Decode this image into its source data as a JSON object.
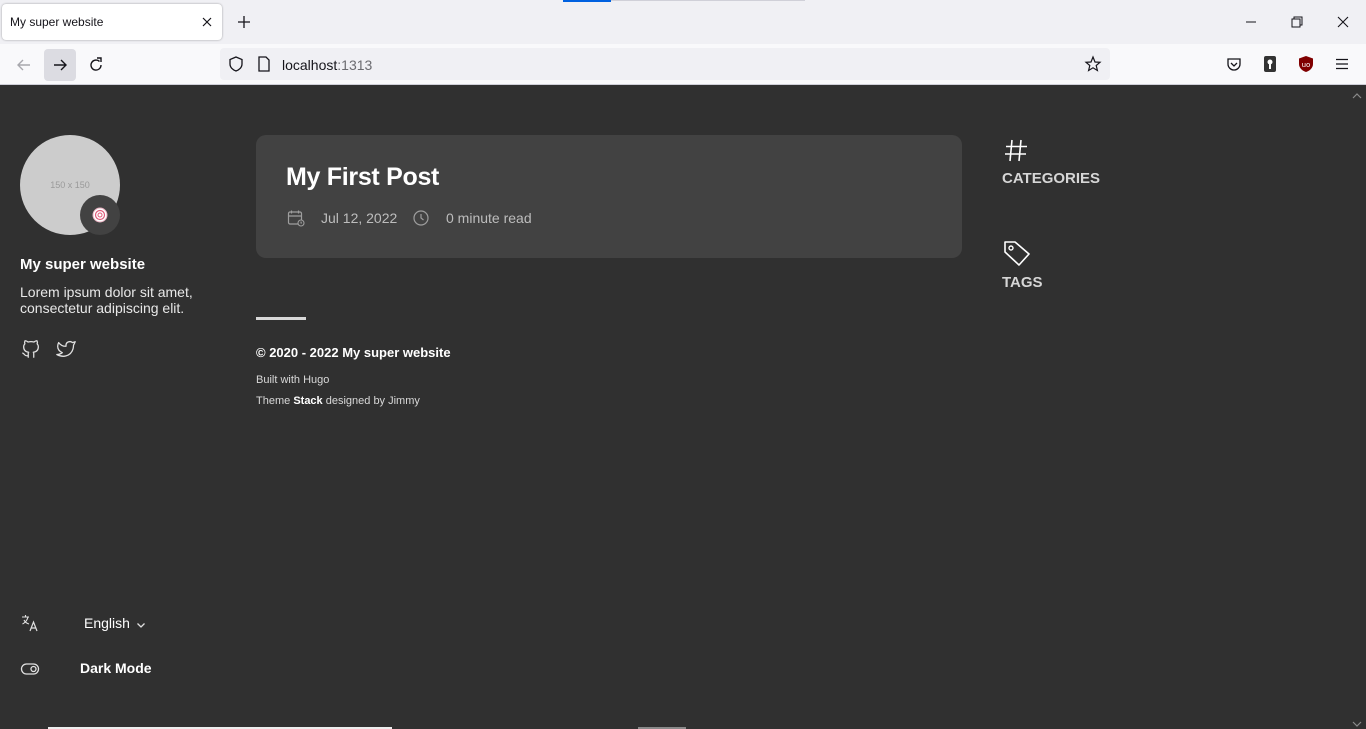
{
  "browser": {
    "tab_title": "My super website",
    "url_host": "localhost",
    "url_port": ":1313"
  },
  "sidebar": {
    "avatar_placeholder": "150 x 150",
    "site_title": "My super website",
    "site_description": "Lorem ipsum dolor sit amet, consectetur adipiscing elit.",
    "language": "English",
    "dark_mode_label": "Dark Mode"
  },
  "post": {
    "title": "My First Post",
    "date": "Jul 12, 2022",
    "read_time": "0 minute read"
  },
  "footer": {
    "copyright": "© 2020 - 2022 My super website",
    "built_with": "Built with Hugo",
    "theme_prefix": "Theme",
    "theme_name": "Stack",
    "theme_suffix": "designed by Jimmy"
  },
  "widgets": {
    "categories_title": "CATEGORIES",
    "tags_title": "TAGS"
  },
  "colors": {
    "page_background": "#303030",
    "card_background": "#424242",
    "tab_accent": "#0061e0"
  }
}
